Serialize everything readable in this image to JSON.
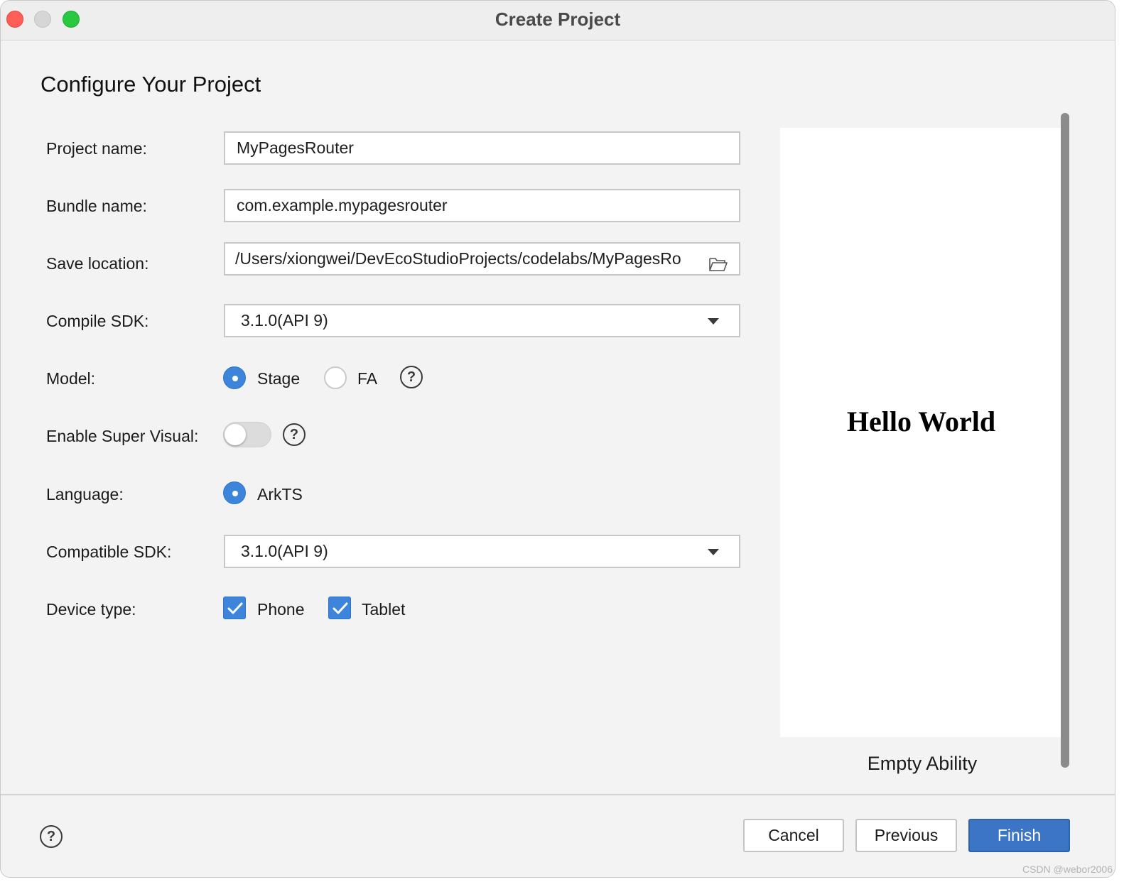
{
  "window": {
    "title": "Create Project"
  },
  "page": {
    "heading": "Configure Your Project"
  },
  "form": {
    "project_name": {
      "label": "Project name:",
      "value": "MyPagesRouter"
    },
    "bundle_name": {
      "label": "Bundle name:",
      "value": "com.example.mypagesrouter"
    },
    "save_location": {
      "label": "Save location:",
      "value": "/Users/xiongwei/DevEcoStudioProjects/codelabs/MyPagesRo"
    },
    "compile_sdk": {
      "label": "Compile SDK:",
      "value": "3.1.0(API 9)"
    },
    "model": {
      "label": "Model:",
      "options": [
        "Stage",
        "FA"
      ],
      "selected": "Stage"
    },
    "super_visual": {
      "label": "Enable Super Visual:",
      "enabled": false
    },
    "language": {
      "label": "Language:",
      "options": [
        "ArkTS"
      ],
      "selected": "ArkTS"
    },
    "compatible_sdk": {
      "label": "Compatible SDK:",
      "value": "3.1.0(API 9)"
    },
    "device_type": {
      "label": "Device type:",
      "options": [
        {
          "label": "Phone",
          "checked": true
        },
        {
          "label": "Tablet",
          "checked": true
        }
      ]
    }
  },
  "help_glyph": "?",
  "preview": {
    "text": "Hello World",
    "caption": "Empty Ability"
  },
  "footer": {
    "cancel_label": "Cancel",
    "previous_label": "Previous",
    "finish_label": "Finish"
  },
  "watermark": "CSDN @webor2006",
  "colors": {
    "accent": "#3d85db",
    "primary_button": "#3c74c6",
    "traffic_close": "#ff5f57",
    "traffic_min": "#d6d6d6",
    "traffic_max": "#28c840"
  },
  "icons": [
    "folder-icon",
    "chevron-down-icon",
    "help-icon",
    "checkmark-icon"
  ]
}
